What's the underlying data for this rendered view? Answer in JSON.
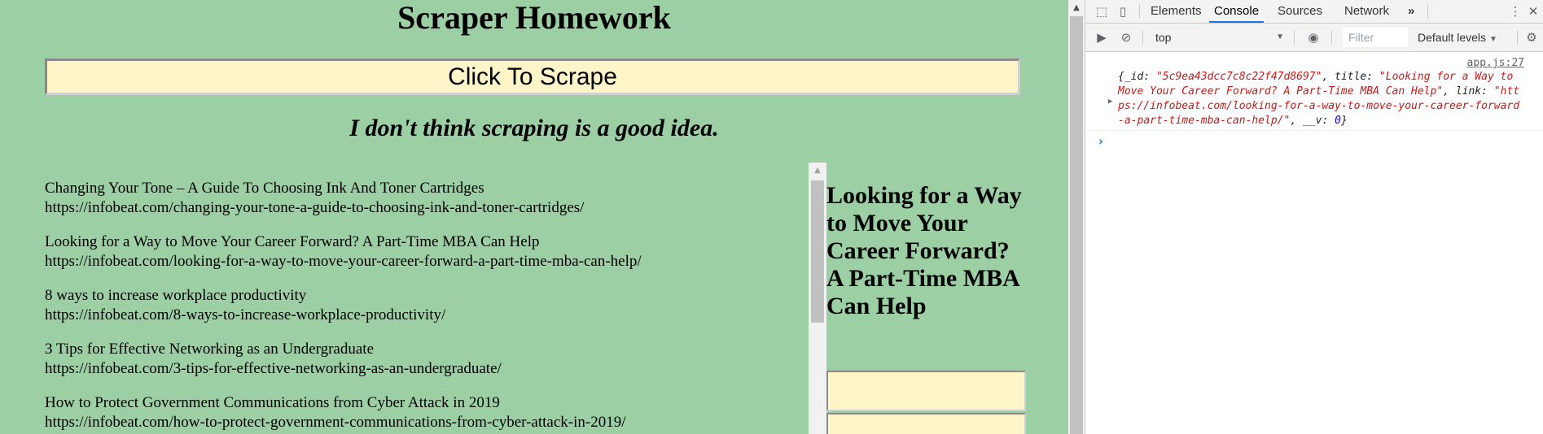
{
  "page": {
    "title": "Scraper Homework",
    "scrape_button": "Click To Scrape",
    "subtitle": "I don't think scraping is a good idea.",
    "articles": [
      {
        "title": "Changing Your Tone – A Guide To Choosing Ink And Toner Cartridges",
        "link": "https://infobeat.com/changing-your-tone-a-guide-to-choosing-ink-and-toner-cartridges/"
      },
      {
        "title": "Looking for a Way to Move Your Career Forward? A Part-Time MBA Can Help",
        "link": "https://infobeat.com/looking-for-a-way-to-move-your-career-forward-a-part-time-mba-can-help/"
      },
      {
        "title": "8 ways to increase workplace productivity",
        "link": "https://infobeat.com/8-ways-to-increase-workplace-productivity/"
      },
      {
        "title": "3 Tips for Effective Networking as an Undergraduate",
        "link": "https://infobeat.com/3-tips-for-effective-networking-as-an-undergraduate/"
      },
      {
        "title": "How to Protect Government Communications from Cyber Attack in 2019",
        "link": "https://infobeat.com/how-to-protect-government-communications-from-cyber-attack-in-2019/"
      }
    ],
    "note_title": "Looking for a Way to Move Your Career Forward? A Part-Time MBA Can Help",
    "background": "#9ccfa4",
    "input_background": "#fdf5c8"
  },
  "devtools": {
    "tabs": [
      "Elements",
      "Console",
      "Sources",
      "Network"
    ],
    "active_tab": "Console",
    "more_tabs": "»",
    "context": "top",
    "filter_placeholder": "Filter",
    "levels": "Default levels",
    "icons": [
      "inspect-icon",
      "device-toolbar-icon",
      "kebab-menu-icon",
      "sidebar-toggle-icon",
      "clear-console-icon",
      "eye-icon",
      "settings-gear-icon"
    ],
    "log": {
      "source": "app.js:27",
      "open_brace": "{",
      "id_key": "_id",
      "id_value": "\"5c9ea43dcc7c8c22f47d8697\"",
      "title_key": "title",
      "title_value": "\"Looking for a Way to Move Your Career Forward? A Part-Time MBA Can Help\"",
      "link_key": "link",
      "link_value": "\"https://infobeat.com/looking-for-a-way-to-move-your-career-forward-a-part-time-mba-can-help/\"",
      "v_key": "__v",
      "v_value": "0",
      "close_brace": "}"
    },
    "prompt": "›",
    "accent": "#1a73e8"
  }
}
